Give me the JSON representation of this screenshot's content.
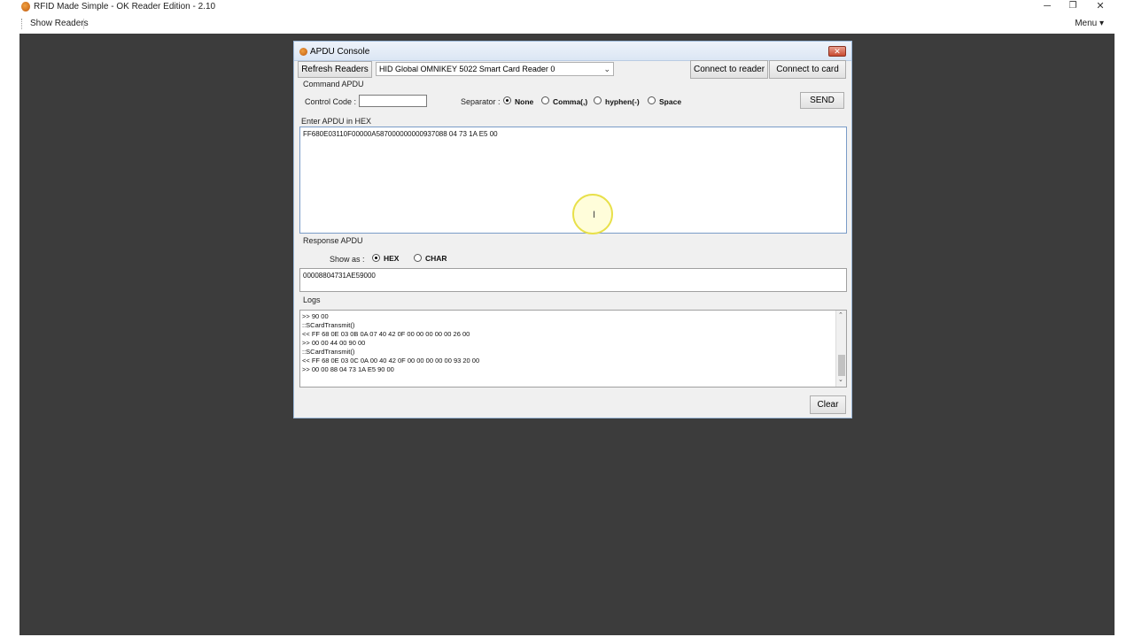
{
  "window": {
    "title": "RFID Made Simple - OK Reader Edition - 2.10",
    "minimize": "─",
    "restore": "❐",
    "close": "✕"
  },
  "menustrip": {
    "show_readers": "Show Readers",
    "menu": "Menu ▾"
  },
  "dialog": {
    "title": "APDU Console",
    "close": "✕",
    "refresh_readers": "Refresh Readers",
    "reader_selected": "HID Global OMNIKEY 5022 Smart Card Reader 0",
    "connect_reader": "Connect to reader",
    "connect_card": "Connect to card",
    "command_group": "Command APDU",
    "control_code_label": "Control Code :",
    "control_code_value": "",
    "separator_label": "Separator :",
    "separator_options": [
      "None",
      "Comma(,)",
      "hyphen(-)",
      "Space"
    ],
    "separator_selected": "None",
    "send": "SEND",
    "enter_hex_label": "Enter APDU in HEX",
    "apdu_hex": "FF680E03110F00000A587000000000937088 04 73 1A E5 00",
    "response_group": "Response APDU",
    "show_as_label": "Show as :",
    "show_as_options": [
      "HEX",
      "CHAR"
    ],
    "show_as_selected": "HEX",
    "response_value": "00008804731AE59000",
    "logs_group": "Logs",
    "logs": [
      ">> 90 00",
      "::SCardTransmit()",
      "<< FF 68 0E 03 0B 0A 07 40 42 0F 00 00 00 00 00 26 00",
      ">> 00 00 44 00 90 00",
      "::SCardTransmit()",
      "<< FF 68 0E 03 0C 0A 00 40 42 0F 00 00 00 00 00 93 20 00",
      ">> 00 00 88 04 73 1A E5 90 00"
    ],
    "clear": "Clear"
  },
  "cursor": "I"
}
